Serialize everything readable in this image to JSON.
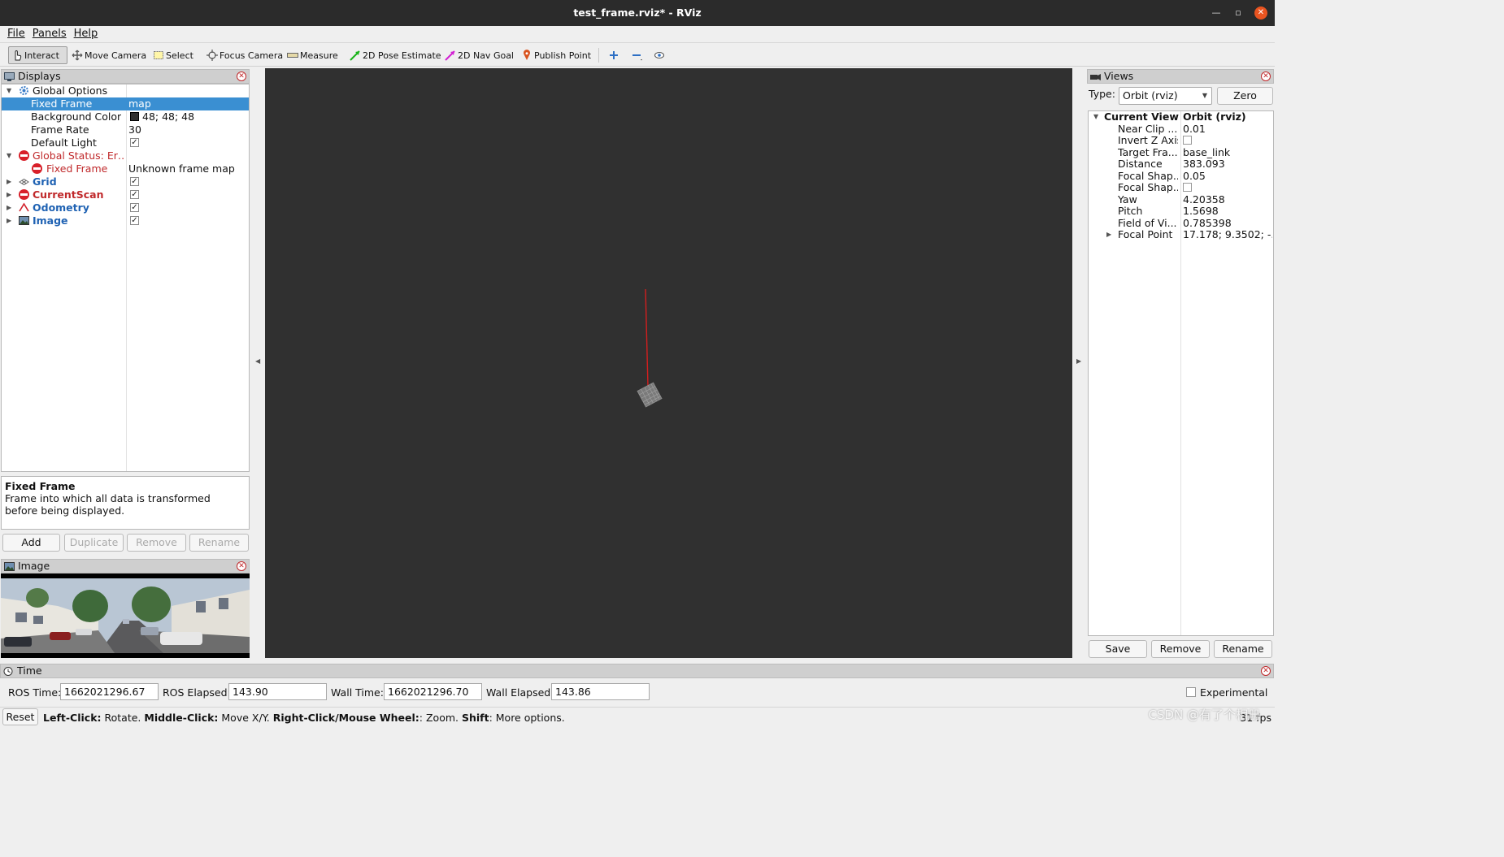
{
  "window": {
    "title": "test_frame.rviz* - RViz"
  },
  "menu": [
    "File",
    "Panels",
    "Help"
  ],
  "toolbar": {
    "interact": "Interact",
    "move_camera": "Move Camera",
    "select": "Select",
    "focus_camera": "Focus Camera",
    "measure": "Measure",
    "pose_estimate": "2D Pose Estimate",
    "nav_goal": "2D Nav Goal",
    "publish_point": "Publish Point"
  },
  "displays": {
    "title": "Displays",
    "global_options": "Global Options",
    "fixed_frame_label": "Fixed Frame",
    "fixed_frame_value": "map",
    "bg_color_label": "Background Color",
    "bg_color_value": "48; 48; 48",
    "bg_color_swatch": "#303030",
    "frame_rate_label": "Frame Rate",
    "frame_rate_value": "30",
    "default_light_label": "Default Light",
    "global_status": "Global Status: Er…",
    "status_fixed_frame": "Fixed Frame",
    "status_fixed_frame_value": "Unknown frame map",
    "grid": "Grid",
    "current_scan": "CurrentScan",
    "odometry": "Odometry",
    "image": "Image"
  },
  "description": {
    "title": "Fixed Frame",
    "text": "Frame into which all data is transformed before being displayed."
  },
  "display_buttons": {
    "add": "Add",
    "duplicate": "Duplicate",
    "remove": "Remove",
    "rename": "Rename"
  },
  "image_panel": {
    "title": "Image"
  },
  "views": {
    "title": "Views",
    "type_label": "Type:",
    "type_value": "Orbit (rviz)",
    "zero": "Zero",
    "current_view": "Current View",
    "current_view_value": "Orbit (rviz)",
    "near_clip": "Near Clip ...",
    "near_clip_value": "0.01",
    "invert_z": "Invert Z Axis",
    "target_frame": "Target Fra...",
    "target_frame_value": "base_link",
    "distance": "Distance",
    "distance_value": "383.093",
    "focal_shape1": "Focal Shap...",
    "focal_shape1_value": "0.05",
    "focal_shape2": "Focal Shap...",
    "yaw": "Yaw",
    "yaw_value": "4.20358",
    "pitch": "Pitch",
    "pitch_value": "1.5698",
    "fov": "Field of Vi...",
    "fov_value": "0.785398",
    "focal_point": "Focal Point",
    "focal_point_value": "17.178; 9.3502; -...",
    "save": "Save",
    "remove": "Remove",
    "rename": "Rename"
  },
  "time": {
    "title": "Time",
    "ros_time_label": "ROS Time:",
    "ros_time": "1662021296.67",
    "ros_elapsed_label": "ROS Elapsed:",
    "ros_elapsed": "143.90",
    "wall_time_label": "Wall Time:",
    "wall_time": "1662021296.70",
    "wall_elapsed_label": "Wall Elapsed:",
    "wall_elapsed": "143.86",
    "experimental": "Experimental"
  },
  "status": {
    "reset": "Reset",
    "left_click": "Left-Click:",
    "left_click_desc": " Rotate. ",
    "middle_click": "Middle-Click:",
    "middle_click_desc": " Move X/Y. ",
    "right_click": "Right-Click/Mouse Wheel:",
    "right_click_desc": ": Zoom. ",
    "shift": "Shift",
    "shift_desc": ": More options.",
    "fps": "31 fps"
  },
  "watermark": "CSDN @有了个相册"
}
